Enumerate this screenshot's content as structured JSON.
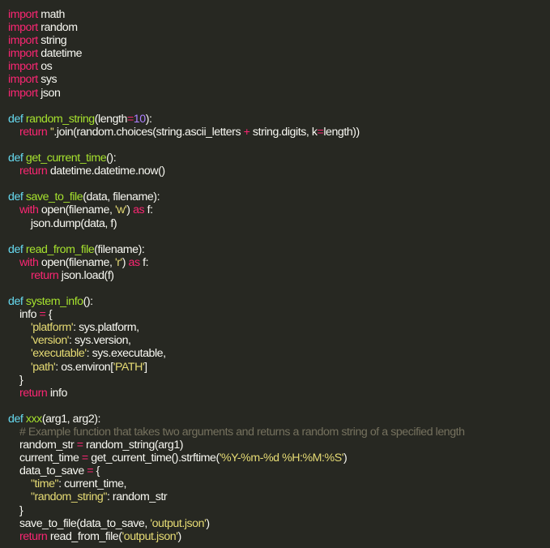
{
  "editor": {
    "lines": [
      [
        {
          "t": "import",
          "c": "keyword"
        },
        {
          "t": " math",
          "c": "plain"
        }
      ],
      [
        {
          "t": "import",
          "c": "keyword"
        },
        {
          "t": " random",
          "c": "plain"
        }
      ],
      [
        {
          "t": "import",
          "c": "keyword"
        },
        {
          "t": " string",
          "c": "plain"
        }
      ],
      [
        {
          "t": "import",
          "c": "keyword"
        },
        {
          "t": " datetime",
          "c": "plain"
        }
      ],
      [
        {
          "t": "import",
          "c": "keyword"
        },
        {
          "t": " os",
          "c": "plain"
        }
      ],
      [
        {
          "t": "import",
          "c": "keyword"
        },
        {
          "t": " sys",
          "c": "plain"
        }
      ],
      [
        {
          "t": "import",
          "c": "keyword"
        },
        {
          "t": " json",
          "c": "plain"
        }
      ],
      [],
      [
        {
          "t": "def",
          "c": "def"
        },
        {
          "t": " ",
          "c": "plain"
        },
        {
          "t": "random_string",
          "c": "func"
        },
        {
          "t": "(length",
          "c": "plain"
        },
        {
          "t": "=",
          "c": "operator"
        },
        {
          "t": "10",
          "c": "number"
        },
        {
          "t": "):",
          "c": "plain"
        }
      ],
      [
        {
          "t": "    ",
          "c": "plain"
        },
        {
          "t": "return",
          "c": "keyword"
        },
        {
          "t": " ",
          "c": "plain"
        },
        {
          "t": "''",
          "c": "string"
        },
        {
          "t": ".join(random.choices(string.ascii_letters ",
          "c": "plain"
        },
        {
          "t": "+",
          "c": "operator"
        },
        {
          "t": " string.digits, k",
          "c": "plain"
        },
        {
          "t": "=",
          "c": "operator"
        },
        {
          "t": "length))",
          "c": "plain"
        }
      ],
      [],
      [
        {
          "t": "def",
          "c": "def"
        },
        {
          "t": " ",
          "c": "plain"
        },
        {
          "t": "get_current_time",
          "c": "func"
        },
        {
          "t": "():",
          "c": "plain"
        }
      ],
      [
        {
          "t": "    ",
          "c": "plain"
        },
        {
          "t": "return",
          "c": "keyword"
        },
        {
          "t": " datetime.datetime.now()",
          "c": "plain"
        }
      ],
      [],
      [
        {
          "t": "def",
          "c": "def"
        },
        {
          "t": " ",
          "c": "plain"
        },
        {
          "t": "save_to_file",
          "c": "func"
        },
        {
          "t": "(data, filename):",
          "c": "plain"
        }
      ],
      [
        {
          "t": "    ",
          "c": "plain"
        },
        {
          "t": "with",
          "c": "keyword"
        },
        {
          "t": " open(filename, ",
          "c": "plain"
        },
        {
          "t": "'w'",
          "c": "string"
        },
        {
          "t": ") ",
          "c": "plain"
        },
        {
          "t": "as",
          "c": "keyword"
        },
        {
          "t": " f:",
          "c": "plain"
        }
      ],
      [
        {
          "t": "        json.dump(data, f)",
          "c": "plain"
        }
      ],
      [],
      [
        {
          "t": "def",
          "c": "def"
        },
        {
          "t": " ",
          "c": "plain"
        },
        {
          "t": "read_from_file",
          "c": "func"
        },
        {
          "t": "(filename):",
          "c": "plain"
        }
      ],
      [
        {
          "t": "    ",
          "c": "plain"
        },
        {
          "t": "with",
          "c": "keyword"
        },
        {
          "t": " open(filename, ",
          "c": "plain"
        },
        {
          "t": "'r'",
          "c": "string"
        },
        {
          "t": ") ",
          "c": "plain"
        },
        {
          "t": "as",
          "c": "keyword"
        },
        {
          "t": " f:",
          "c": "plain"
        }
      ],
      [
        {
          "t": "        ",
          "c": "plain"
        },
        {
          "t": "return",
          "c": "keyword"
        },
        {
          "t": " json.load(f)",
          "c": "plain"
        }
      ],
      [],
      [
        {
          "t": "def",
          "c": "def"
        },
        {
          "t": " ",
          "c": "plain"
        },
        {
          "t": "system_info",
          "c": "func"
        },
        {
          "t": "():",
          "c": "plain"
        }
      ],
      [
        {
          "t": "    info ",
          "c": "plain"
        },
        {
          "t": "=",
          "c": "operator"
        },
        {
          "t": " {",
          "c": "plain"
        }
      ],
      [
        {
          "t": "        ",
          "c": "plain"
        },
        {
          "t": "'platform'",
          "c": "string"
        },
        {
          "t": ": sys.platform,",
          "c": "plain"
        }
      ],
      [
        {
          "t": "        ",
          "c": "plain"
        },
        {
          "t": "'version'",
          "c": "string"
        },
        {
          "t": ": sys.version,",
          "c": "plain"
        }
      ],
      [
        {
          "t": "        ",
          "c": "plain"
        },
        {
          "t": "'executable'",
          "c": "string"
        },
        {
          "t": ": sys.executable,",
          "c": "plain"
        }
      ],
      [
        {
          "t": "        ",
          "c": "plain"
        },
        {
          "t": "'path'",
          "c": "string"
        },
        {
          "t": ": os.environ[",
          "c": "plain"
        },
        {
          "t": "'PATH'",
          "c": "string"
        },
        {
          "t": "]",
          "c": "plain"
        }
      ],
      [
        {
          "t": "    }",
          "c": "plain"
        }
      ],
      [
        {
          "t": "    ",
          "c": "plain"
        },
        {
          "t": "return",
          "c": "keyword"
        },
        {
          "t": " info",
          "c": "plain"
        }
      ],
      [],
      [
        {
          "t": "def",
          "c": "def"
        },
        {
          "t": " ",
          "c": "plain"
        },
        {
          "t": "xxx",
          "c": "func"
        },
        {
          "t": "(arg1, arg2):",
          "c": "plain"
        }
      ],
      [
        {
          "t": "    ",
          "c": "plain"
        },
        {
          "t": "# Example function that takes two arguments and returns a random string of a specified length",
          "c": "comment"
        }
      ],
      [
        {
          "t": "    random_str ",
          "c": "plain"
        },
        {
          "t": "=",
          "c": "operator"
        },
        {
          "t": " random_string(arg1)",
          "c": "plain"
        }
      ],
      [
        {
          "t": "    current_time ",
          "c": "plain"
        },
        {
          "t": "=",
          "c": "operator"
        },
        {
          "t": " get_current_time().strftime(",
          "c": "plain"
        },
        {
          "t": "'%Y-%m-%d %H:%M:%S'",
          "c": "string"
        },
        {
          "t": ")",
          "c": "plain"
        }
      ],
      [
        {
          "t": "    data_to_save ",
          "c": "plain"
        },
        {
          "t": "=",
          "c": "operator"
        },
        {
          "t": " {",
          "c": "plain"
        }
      ],
      [
        {
          "t": "        ",
          "c": "plain"
        },
        {
          "t": "\"time\"",
          "c": "string"
        },
        {
          "t": ": current_time,",
          "c": "plain"
        }
      ],
      [
        {
          "t": "        ",
          "c": "plain"
        },
        {
          "t": "\"random_string\"",
          "c": "string"
        },
        {
          "t": ": random_str",
          "c": "plain"
        }
      ],
      [
        {
          "t": "    }",
          "c": "plain"
        }
      ],
      [
        {
          "t": "    save_to_file(data_to_save, ",
          "c": "plain"
        },
        {
          "t": "'output.json'",
          "c": "string"
        },
        {
          "t": ")",
          "c": "plain"
        }
      ],
      [
        {
          "t": "    ",
          "c": "plain"
        },
        {
          "t": "return",
          "c": "keyword"
        },
        {
          "t": " read_from_file(",
          "c": "plain"
        },
        {
          "t": "'output.json'",
          "c": "string"
        },
        {
          "t": ")",
          "c": "plain"
        }
      ]
    ]
  },
  "theme": {
    "background": "#272822",
    "keyword": "#f92672",
    "def": "#66d9ef",
    "function": "#a6e22e",
    "string": "#e6db74",
    "number": "#ae81ff",
    "comment": "#75715e",
    "text": "#f8f8f2"
  }
}
